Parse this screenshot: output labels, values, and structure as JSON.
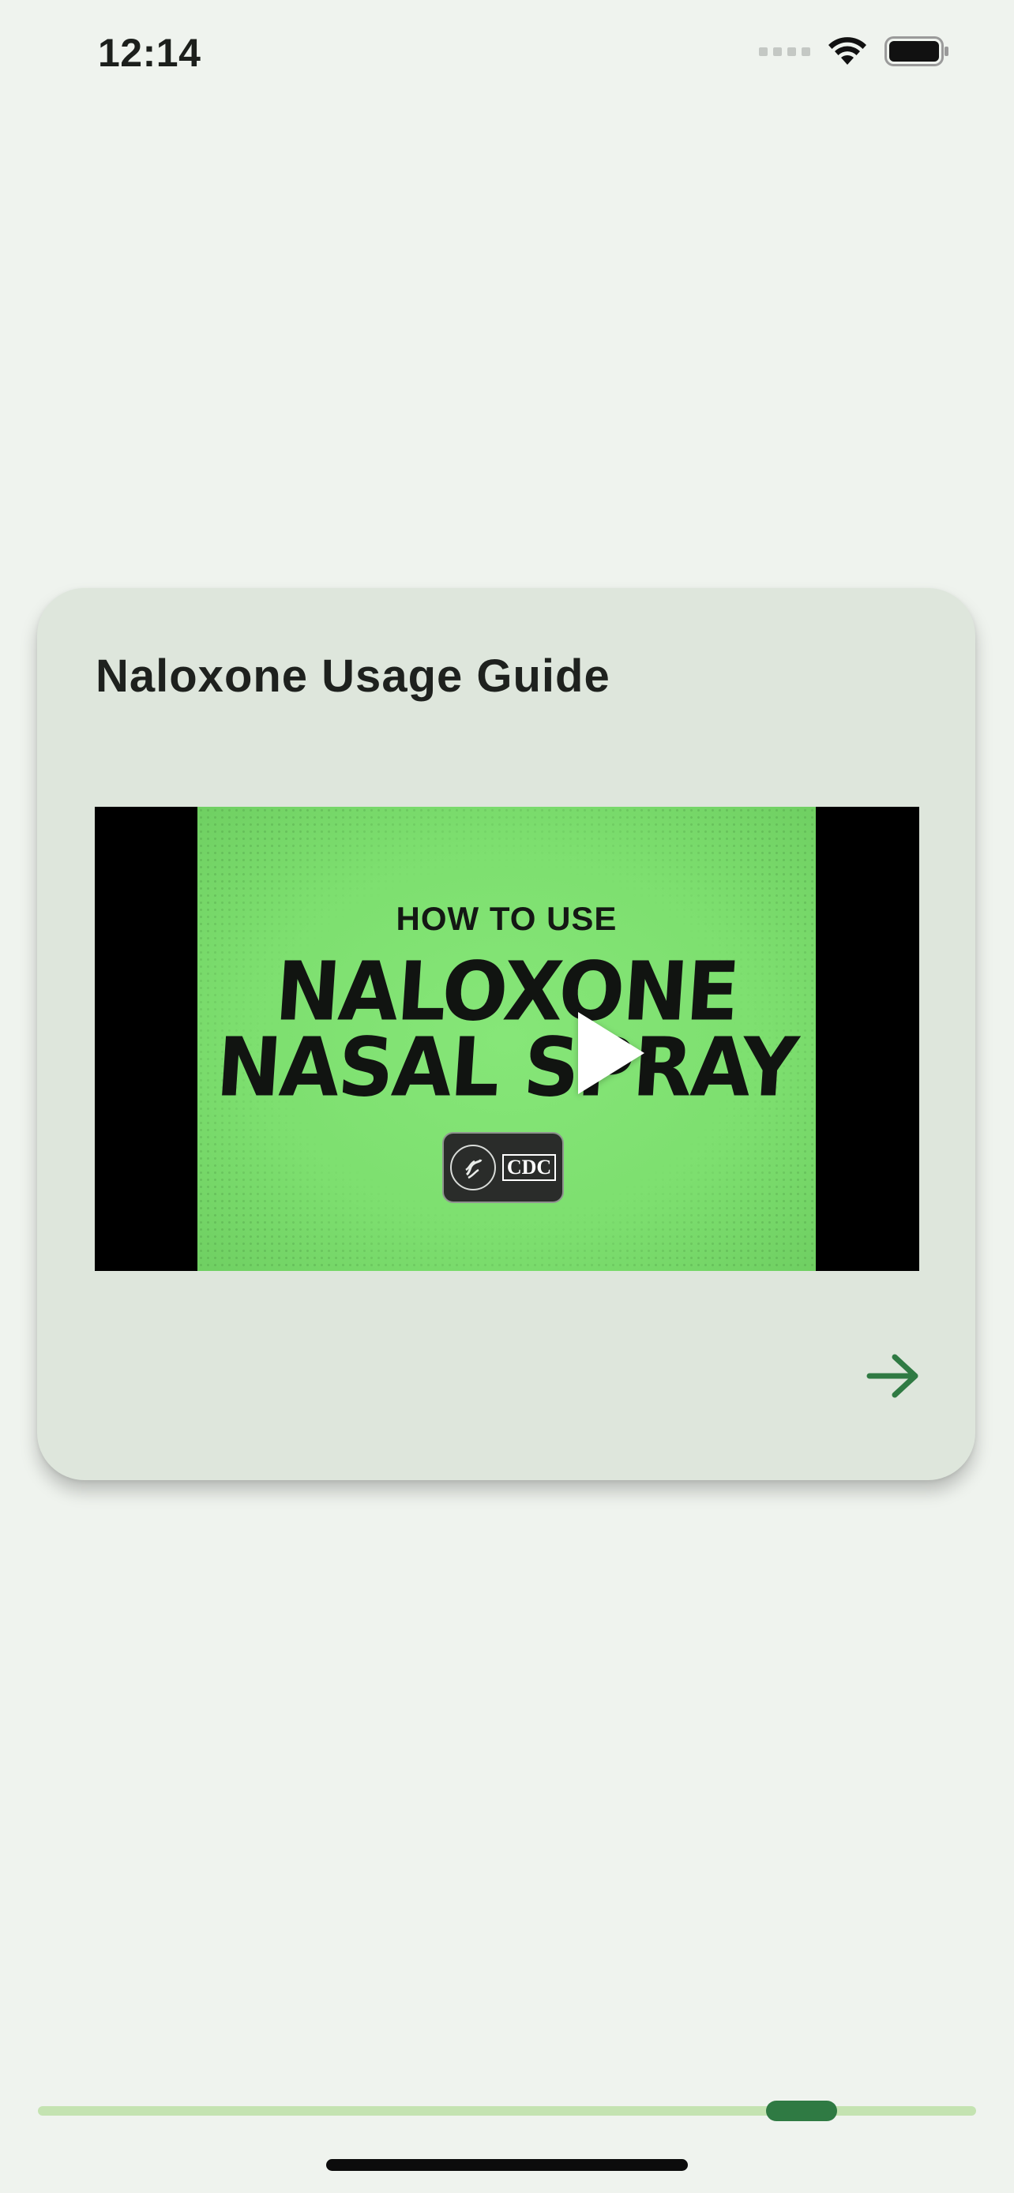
{
  "status_bar": {
    "time": "12:14"
  },
  "card": {
    "title": "Naloxone Usage Guide",
    "video": {
      "thumbnail_heading": "HOW TO USE",
      "thumbnail_line1": "NALOXONE",
      "thumbnail_line2": "NASAL SPRAY",
      "badge_text": "CDC",
      "play_icon": "play-icon"
    },
    "next_icon": "arrow-right-icon",
    "accent_color": "#2f7a43"
  },
  "pager": {
    "current_position_fraction": 0.84,
    "track_color": "#c4e3b1",
    "thumb_color": "#2f7a43"
  }
}
